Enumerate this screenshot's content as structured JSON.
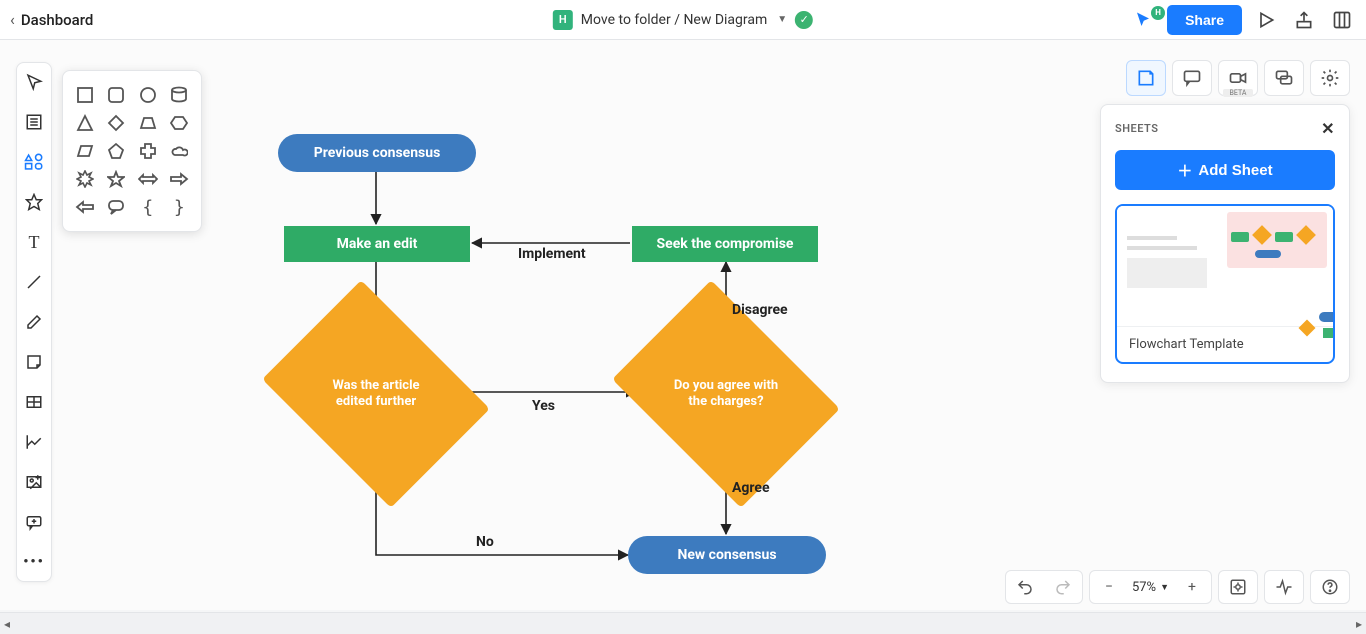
{
  "header": {
    "back_label": "Dashboard",
    "doc_badge": "H",
    "doc_title": "Move to folder / New Diagram",
    "share_label": "Share",
    "user_badge": "H"
  },
  "right_strip": {
    "beta_tag": "BETA"
  },
  "sheets_panel": {
    "title": "SHEETS",
    "add_button": "Add Sheet",
    "card_name": "Flowchart Template"
  },
  "zoom": {
    "level": "57%"
  },
  "flow": {
    "nodes": {
      "prev_consensus": "Previous consensus",
      "make_edit": "Make an edit",
      "seek_compromise": "Seek the compromise",
      "was_edited": "Was the article edited further",
      "agree_charges": "Do you agree with the charges?",
      "new_consensus": "New consensus"
    },
    "edges": {
      "implement": "Implement",
      "disagree": "Disagree",
      "yes": "Yes",
      "agree": "Agree",
      "no": "No"
    }
  }
}
